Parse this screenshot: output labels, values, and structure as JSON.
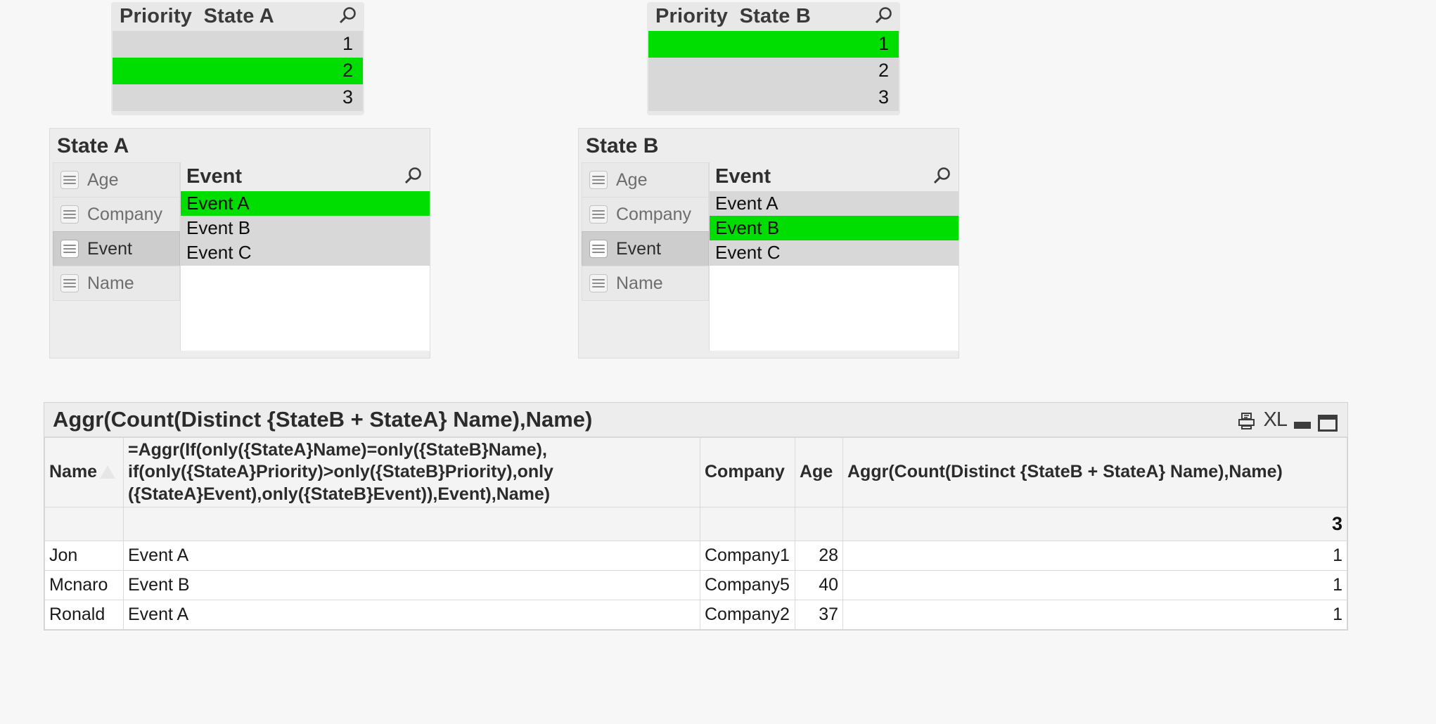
{
  "priority_state_a": {
    "caption": "Priority  State A",
    "search_icon": "magnifier-icon",
    "values": [
      {
        "label": "1",
        "selected": false
      },
      {
        "label": "2",
        "selected": true
      },
      {
        "label": "3",
        "selected": false
      }
    ]
  },
  "priority_state_b": {
    "caption": "Priority  State B",
    "search_icon": "magnifier-icon",
    "values": [
      {
        "label": "1",
        "selected": true
      },
      {
        "label": "2",
        "selected": false
      },
      {
        "label": "3",
        "selected": false
      }
    ]
  },
  "state_a_panel": {
    "title": "State A",
    "fields": [
      {
        "label": "Age",
        "active": false
      },
      {
        "label": "Company",
        "active": false
      },
      {
        "label": "Event",
        "active": true
      },
      {
        "label": "Name",
        "active": false
      }
    ],
    "value_list": {
      "caption": "Event",
      "search_icon": "magnifier-icon",
      "values": [
        {
          "label": "Event A",
          "selected": true
        },
        {
          "label": "Event B",
          "selected": false
        },
        {
          "label": "Event C",
          "selected": false
        }
      ]
    }
  },
  "state_b_panel": {
    "title": "State B",
    "fields": [
      {
        "label": "Age",
        "active": false
      },
      {
        "label": "Company",
        "active": false
      },
      {
        "label": "Event",
        "active": true
      },
      {
        "label": "Name",
        "active": false
      }
    ],
    "value_list": {
      "caption": "Event",
      "search_icon": "magnifier-icon",
      "values": [
        {
          "label": "Event A",
          "selected": false
        },
        {
          "label": "Event B",
          "selected": true
        },
        {
          "label": "Event C",
          "selected": false
        }
      ]
    }
  },
  "table_object": {
    "title": "Aggr(Count(Distinct {StateB + StateA} Name),Name)",
    "window_icons": [
      "print-icon",
      "excel-export-icon",
      "minimize-icon",
      "maximize-icon"
    ],
    "excel_label": "XL",
    "columns": {
      "name": "Name",
      "expression": "=Aggr(If(only({StateA}Name)=only({StateB}Name),\n if(only({StateA}Priority)>only({StateB}Priority),only\n({StateA}Event),only({StateB}Event)),Event),Name)",
      "company": "Company",
      "age": "Age",
      "aggr": "Aggr(Count(Distinct {StateB + StateA} Name),Name)"
    },
    "total_row": {
      "name": "",
      "expression": "",
      "company": "",
      "age": "",
      "aggr": "3"
    },
    "rows": [
      {
        "name": "Jon",
        "expression": "Event A",
        "company": "Company1",
        "age": "28",
        "aggr": "1"
      },
      {
        "name": "Mcnaro",
        "expression": "Event B",
        "company": "Company5",
        "age": "40",
        "aggr": "1"
      },
      {
        "name": "Ronald",
        "expression": "Event A",
        "company": "Company2",
        "age": "37",
        "aggr": "1"
      }
    ]
  },
  "colors": {
    "selection_green": "#00dd00",
    "panel_grey": "#ededed",
    "row_grey": "#d8d8d8",
    "page_background": "#f7f7f7"
  }
}
